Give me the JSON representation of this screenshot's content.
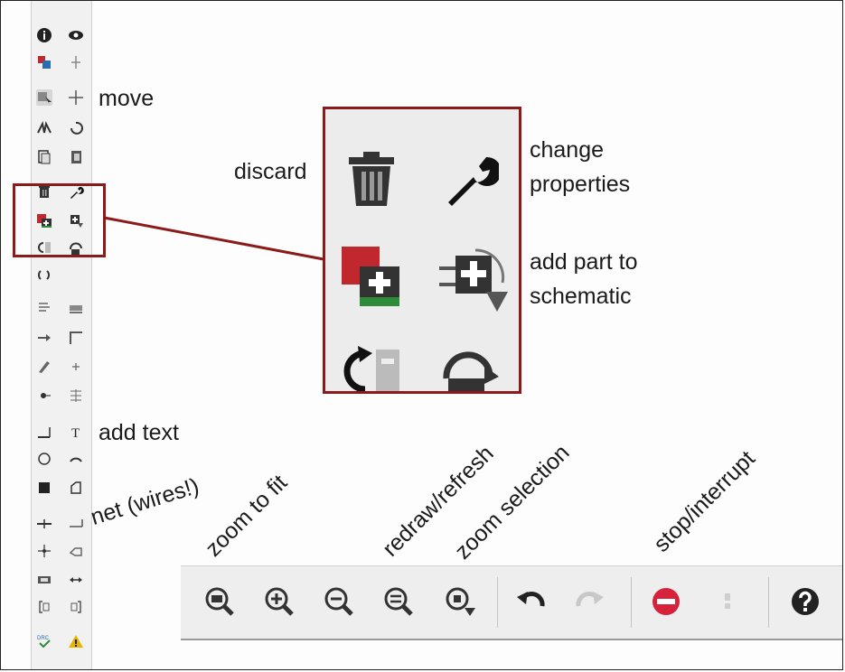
{
  "annotations": {
    "move": "move",
    "discard": "discard",
    "change_properties": [
      "change",
      "properties"
    ],
    "add_part": [
      "add part to",
      "schematic"
    ],
    "add_text": "add text",
    "net": "net (wires!)",
    "zoom_to_fit": "zoom to fit",
    "redraw_refresh": "redraw/refresh",
    "zoom_selection": "zoom selection",
    "stop_interrupt": "stop/interrupt"
  },
  "toolbar_icons": [
    [
      "info-icon",
      "eye-icon"
    ],
    [
      "symbol-add-icon",
      "pin-icon"
    ],
    [
      "select-icon",
      "move-icon"
    ],
    [
      "mirror-icon",
      "rotate-icon"
    ],
    [
      "copy-icon",
      "paste-icon"
    ],
    [
      "trash-icon",
      "wrench-icon"
    ],
    [
      "add-part-icon",
      "add-part-schematic-icon"
    ],
    [
      "refresh-left-icon",
      "refresh-part-icon"
    ],
    [
      "cycle-icon",
      ""
    ],
    [
      "align-icon",
      "bus-icon"
    ],
    [
      "arrow-right-icon",
      "angle-icon"
    ],
    [
      "probe-icon",
      "plus-small-icon"
    ],
    [
      "dot-icon",
      "hatch-icon"
    ],
    [
      "line-icon",
      "text-icon"
    ],
    [
      "circle-icon",
      "arc-icon"
    ],
    [
      "fill-rect-icon",
      "polygon-icon"
    ],
    [
      "net-icon",
      "wire-end-icon"
    ],
    [
      "junction-icon",
      "label-icon"
    ],
    [
      "frame-icon",
      "arrows-h-icon"
    ],
    [
      "bracket-left-icon",
      "bracket-right-icon"
    ],
    [
      "drc-check-icon",
      "warning-icon"
    ]
  ],
  "zoom_box_icons": [
    "trash-icon",
    "wrench-icon",
    "add-part-icon",
    "add-part-schematic-icon",
    "refresh-left-icon",
    "refresh-part-icon"
  ],
  "bottom_toolbar_icons": [
    "zoom-fit-icon",
    "zoom-in-icon",
    "zoom-out-icon",
    "zoom-refresh-icon",
    "zoom-selection-icon",
    "undo-icon",
    "redo-icon",
    "stop-icon",
    "disabled-icon",
    "help-icon"
  ],
  "colors": {
    "highlight_red": "#8b1a1a",
    "stop_red": "#d6223b",
    "add_green": "#2e8b3a"
  }
}
